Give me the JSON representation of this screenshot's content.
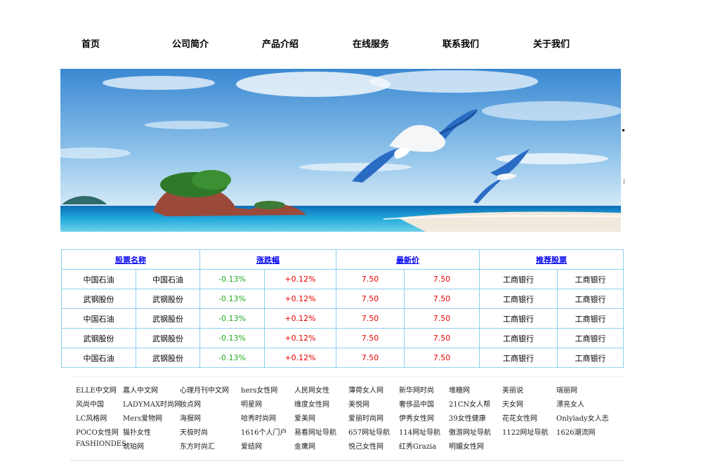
{
  "nav": {
    "items": [
      "首页",
      "公司简介",
      "产品介绍",
      "在线服务",
      "联系我们",
      "关于我们"
    ]
  },
  "banner": {
    "icon": "seagull-beach-photo",
    "colors": {
      "sky_top": "#3f8fd6",
      "sky_bottom": "#cfe6f6",
      "sea": "#1aa6d9",
      "sand": "#f3ebde"
    }
  },
  "stock_table": {
    "headers": [
      "股票名称",
      "涨跌幅",
      "最新价",
      "推荐股票"
    ],
    "rows": [
      [
        "中国石油",
        "中国石油",
        "-0.13%",
        "+0.12%",
        "7.50",
        "7.50",
        "工商银行",
        "工商银行"
      ],
      [
        "武钢股份",
        "武钢股份",
        "-0.13%",
        "+0.12%",
        "7.50",
        "7.50",
        "工商银行",
        "工商银行"
      ],
      [
        "中国石油",
        "武钢股份",
        "-0.13%",
        "+0.12%",
        "7.50",
        "7.50",
        "工商银行",
        "工商银行"
      ],
      [
        "武钢股份",
        "武钢股份",
        "-0.13%",
        "+0.12%",
        "7.50",
        "7.50",
        "工商银行",
        "工商银行"
      ],
      [
        "中国石油",
        "武钢股份",
        "-0.13%",
        "+0.12%",
        "7.50",
        "7.50",
        "工商银行",
        "工商银行"
      ]
    ],
    "colors": {
      "header": "#0000ee",
      "down": "#22aa22",
      "up": "#ee0000",
      "border": "#8fcff0"
    }
  },
  "friend_links": {
    "rows": [
      [
        "ELLE中文网",
        "嘉人中文网",
        "心理月刊中文网",
        "hers女性网",
        "人民网女性",
        "薄荷女人网",
        "新华网时尚",
        "堆糖网",
        "美丽说",
        "瑞丽网"
      ],
      [
        "风尚中国",
        "LADYMAX时尚网",
        "妆点网",
        "明星网",
        "维度女性网",
        "美悦网",
        "奢侈品中国",
        "21CN女人帮",
        "天女网",
        "漂亮女人"
      ],
      [
        "LC风格网",
        "Mers爱物网",
        "海报网",
        "哈秀时尚网",
        "爱美网",
        "爱丽时尚网",
        "伊秀女性网",
        "39女性健康",
        "花花女性网",
        "Onlylady女人志"
      ],
      [
        "POCO女性网",
        "猫扑女性",
        "天极时尚",
        "1616个人门户",
        "易看网址导航",
        "657网址导航",
        "114网址导航",
        "傲游网址导航",
        "1122网址导航",
        "1626潮流网"
      ],
      [
        "FASHIONDES",
        "琥珀网",
        "东方时尚汇",
        "爱结网",
        "金鹰网",
        "悦己女性网",
        "红秀Grazia",
        "明媚女性网"
      ]
    ]
  }
}
